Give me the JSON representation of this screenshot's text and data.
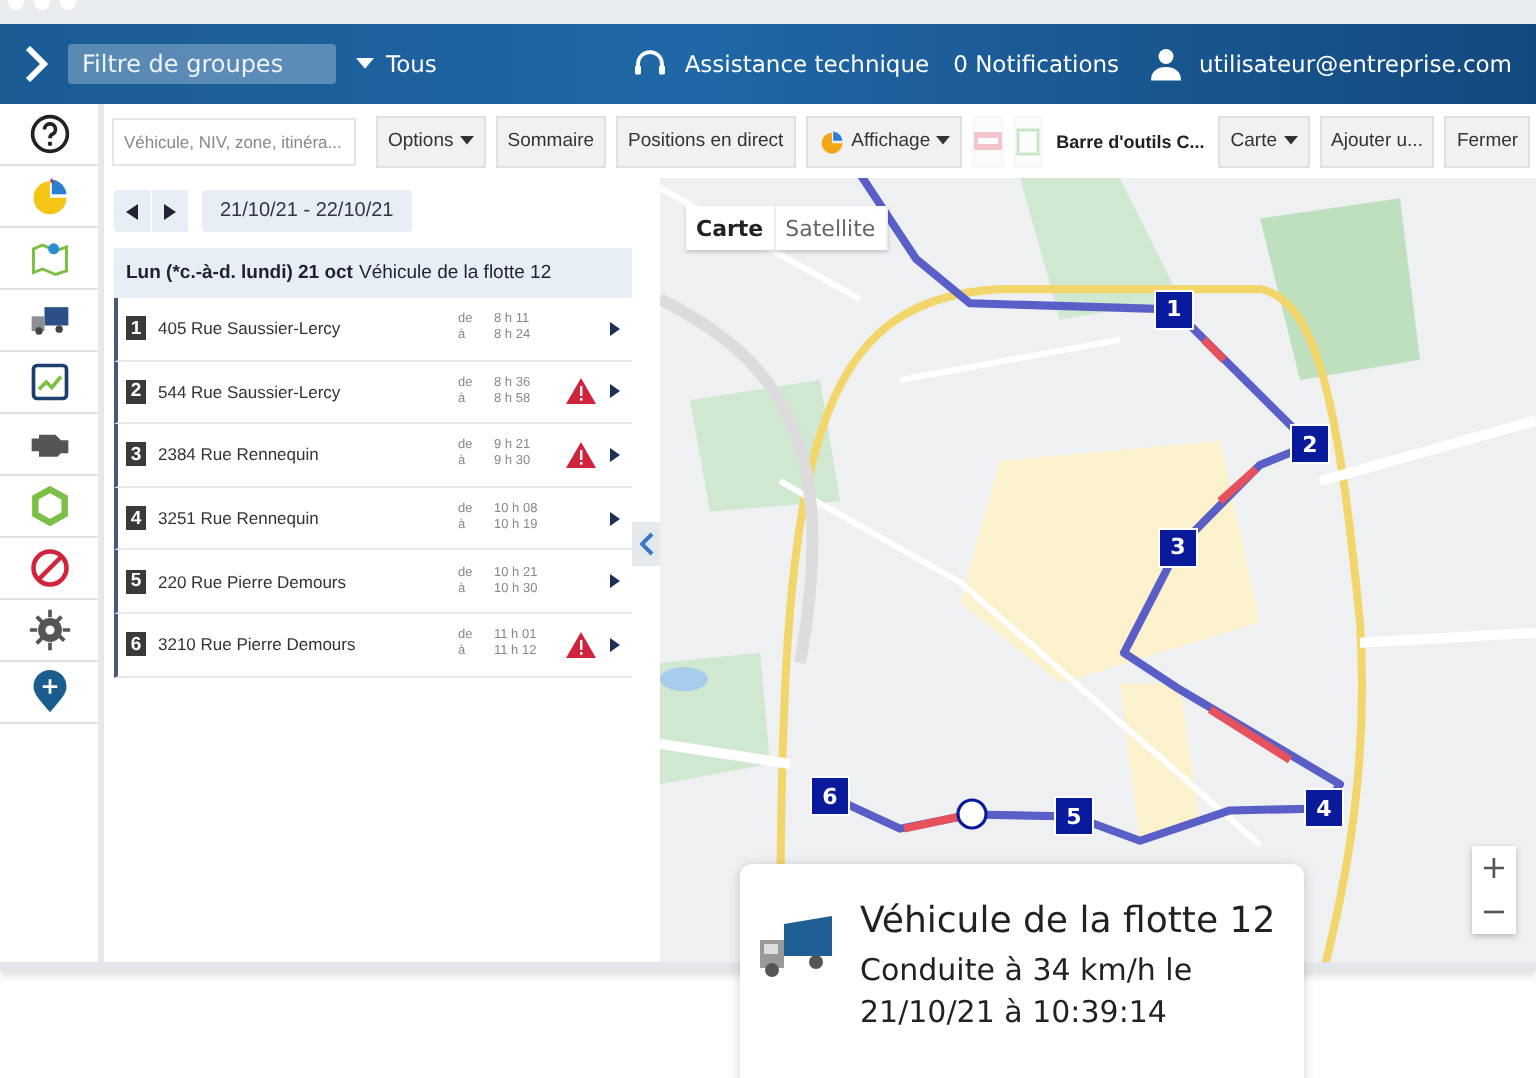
{
  "header": {
    "group_filter": {
      "placeholder": "Filtre de groupes"
    },
    "group_scope": "Tous",
    "support": "Assistance technique",
    "notifications": "0 Notifications",
    "user": "utilisateur@entreprise.com"
  },
  "toolbar": {
    "search": {
      "placeholder": "Véhicule, NIV, zone, itinéra..."
    },
    "items": [
      {
        "kind": "menu",
        "label": "Options"
      },
      {
        "kind": "button",
        "label": "Sommaire"
      },
      {
        "kind": "button",
        "label": "Positions en direct"
      },
      {
        "kind": "pie-menu",
        "label": "Affichage"
      },
      {
        "kind": "pdf",
        "disabled": true
      },
      {
        "kind": "sheet",
        "disabled": true
      },
      {
        "kind": "title",
        "label": "Barre d'outils C..."
      },
      {
        "kind": "menu",
        "label": "Carte"
      },
      {
        "kind": "button",
        "label": "Ajouter u..."
      },
      {
        "kind": "button",
        "label": "Fermer"
      }
    ]
  },
  "trip": {
    "range": "21/10/21 - 22/10/21",
    "day": "Lun (*c.-à-d. lundi) 21 oct",
    "vehicle": "Véhicule de la flotte 12",
    "stops": [
      {
        "number": "1",
        "address": "405 Rue Saussier-Lercy",
        "from_label": "de",
        "from": "8 h 11",
        "to_label": "à",
        "to": "8 h 24",
        "warning": false
      },
      {
        "number": "2",
        "address": "544 Rue Saussier-Lercy",
        "from_label": "de",
        "from": "8 h 36",
        "to_label": "à",
        "to": "8 h 58",
        "warning": true
      },
      {
        "number": "3",
        "address": "2384 Rue Rennequin",
        "from_label": "de",
        "from": "9 h 21",
        "to_label": "à",
        "to": "9 h 30",
        "warning": true
      },
      {
        "number": "4",
        "address": "3251 Rue Rennequin",
        "from_label": "de",
        "from": "10 h 08",
        "to_label": "à",
        "to": "10 h 19",
        "warning": false
      },
      {
        "number": "5",
        "address": "220 Rue Pierre Demours",
        "from_label": "de",
        "from": "10 h 21",
        "to_label": "à",
        "to": "10 h 30",
        "warning": false
      },
      {
        "number": "6",
        "address": "3210 Rue Pierre Demours",
        "from_label": "de",
        "from": "11 h 01",
        "to_label": "à",
        "to": "11 h 12",
        "warning": true
      }
    ]
  },
  "map": {
    "types": [
      {
        "label": "Carte",
        "selected": true
      },
      {
        "label": "Satellite",
        "selected": false
      }
    ],
    "markers": [
      {
        "label": "1"
      },
      {
        "label": "2"
      },
      {
        "label": "3"
      },
      {
        "label": "4"
      },
      {
        "label": "5"
      },
      {
        "label": "6"
      }
    ],
    "zoom_in": "+",
    "zoom_out": "−"
  },
  "popup": {
    "title": "Véhicule de la flotte 12",
    "status": "Conduite à 34 km/h le 21/10/21 à 10:39:14"
  }
}
